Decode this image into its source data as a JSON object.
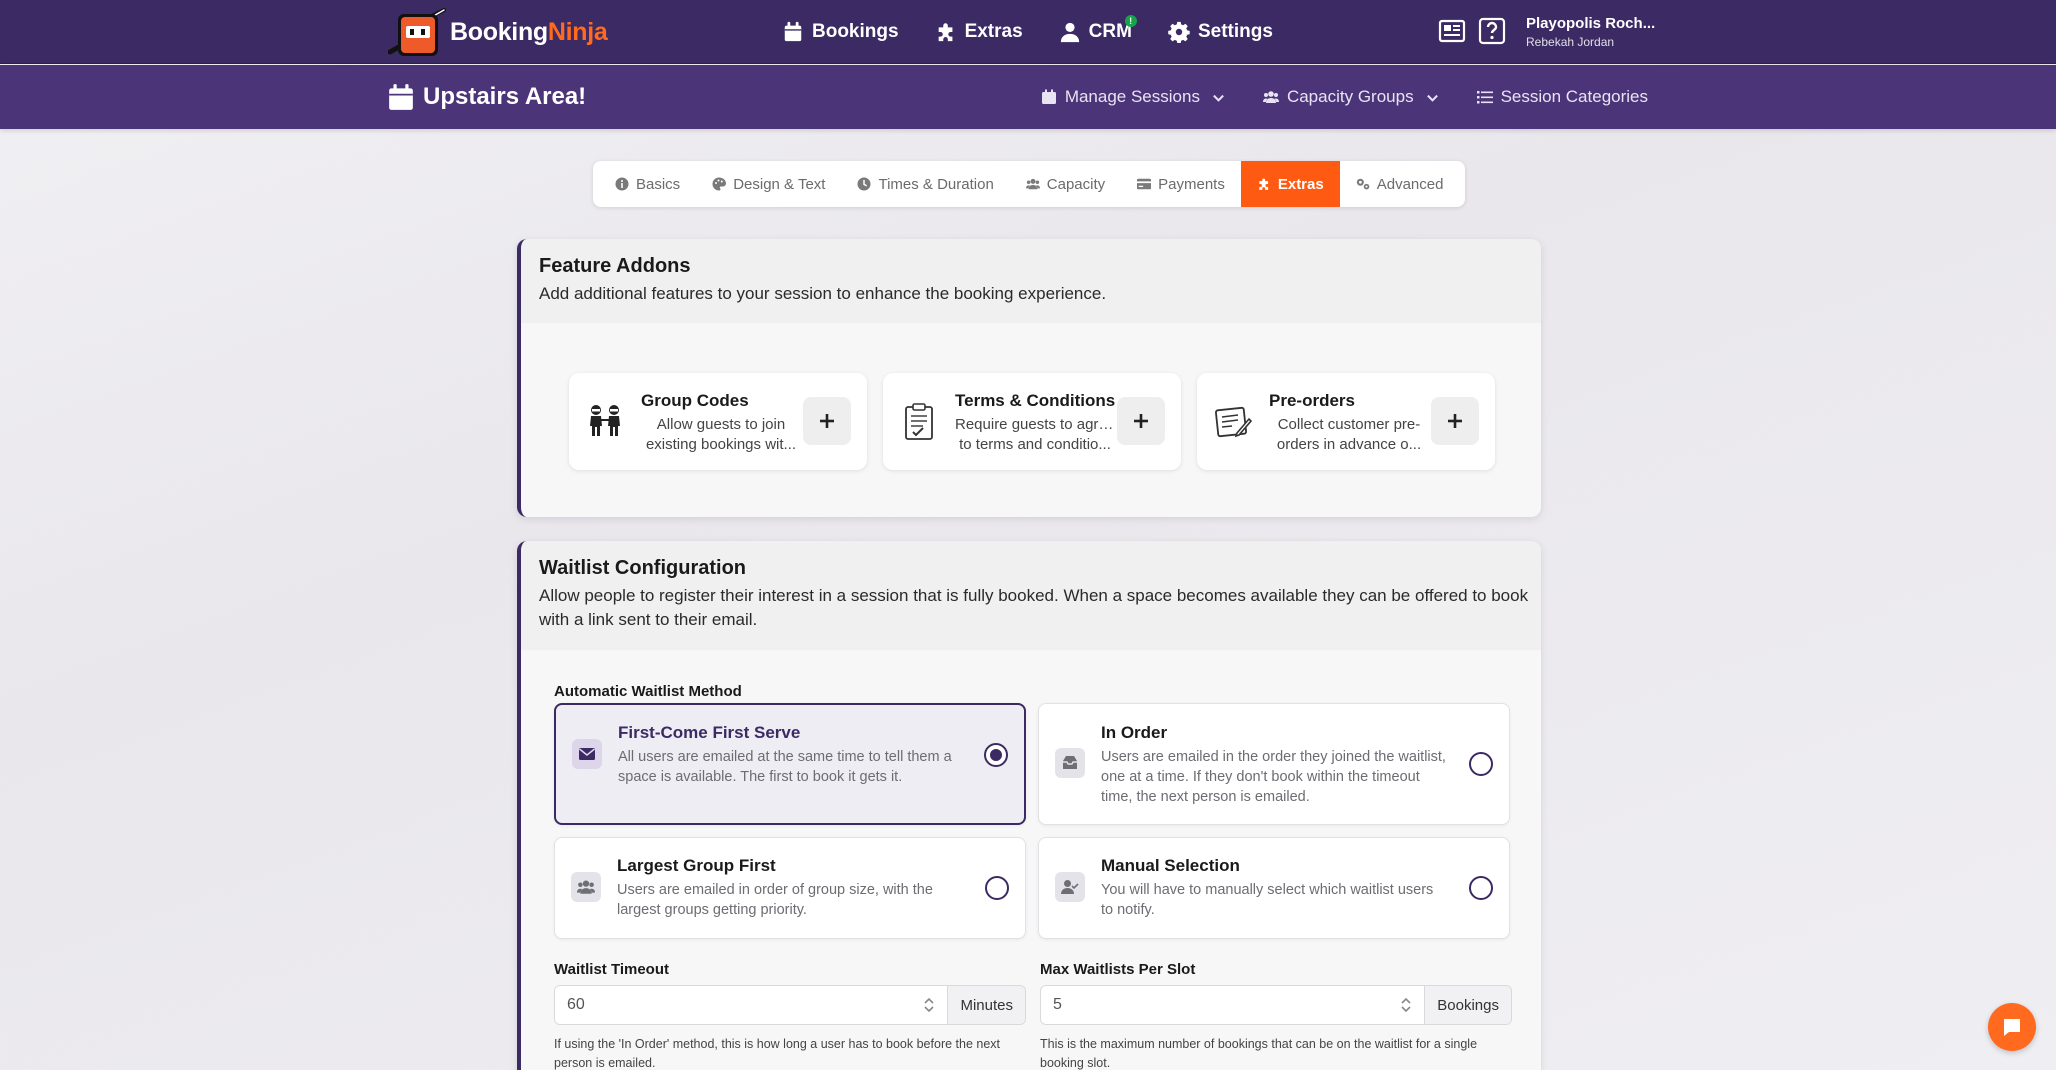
{
  "brand": {
    "name_main": "Booking",
    "name_accent": "Ninja",
    "accent_color": "#ff6a1f",
    "primary_color": "#3b2a63"
  },
  "main_nav": [
    {
      "label": "Bookings",
      "icon": "calendar-icon"
    },
    {
      "label": "Extras",
      "icon": "puzzle-icon"
    },
    {
      "label": "CRM",
      "icon": "user-icon",
      "badge": "!"
    },
    {
      "label": "Settings",
      "icon": "gear-icon"
    }
  ],
  "top_icons": [
    "newspaper-icon",
    "help-icon"
  ],
  "user": {
    "org": "Playopolis Roch...",
    "name": "Rebekah Jordan"
  },
  "page": {
    "title": "Upstairs Area!"
  },
  "sub_nav": [
    {
      "label": "Manage Sessions",
      "icon": "calendar-icon",
      "dropdown": true
    },
    {
      "label": "Capacity Groups",
      "icon": "users-icon",
      "dropdown": true
    },
    {
      "label": "Session Categories",
      "icon": "list-icon",
      "dropdown": false
    }
  ],
  "tabs": [
    {
      "label": "Basics",
      "icon": "info-icon"
    },
    {
      "label": "Design & Text",
      "icon": "palette-icon"
    },
    {
      "label": "Times & Duration",
      "icon": "clock-icon"
    },
    {
      "label": "Capacity",
      "icon": "users-icon"
    },
    {
      "label": "Payments",
      "icon": "credit-card-icon"
    },
    {
      "label": "Extras",
      "icon": "puzzle-icon",
      "active": true
    },
    {
      "label": "Advanced",
      "icon": "cogs-icon"
    }
  ],
  "feature_addons": {
    "title": "Feature Addons",
    "description": "Add additional features to your session to enhance the booking experience.",
    "items": [
      {
        "title": "Group Codes",
        "line1": "Allow guests to join",
        "line2": "existing bookings wit...",
        "icon": "ninjas-icon"
      },
      {
        "title": "Terms & Conditions",
        "line1": "Require guests to agree",
        "line2": "to terms and conditio...",
        "icon": "clipboard-icon"
      },
      {
        "title": "Pre-orders",
        "line1": "Collect customer pre-",
        "line2": "orders in advance o...",
        "icon": "order-form-icon"
      }
    ]
  },
  "waitlist": {
    "title": "Waitlist Configuration",
    "description": "Allow people to register their interest in a session that is fully booked. When a space becomes available they can be offered to book with a link sent to their email.",
    "method_label": "Automatic Waitlist Method",
    "methods": [
      {
        "title": "First-Come First Serve",
        "description": "All users are emailed at the same time to tell them a space is available. The first to book it gets it.",
        "icon": "envelope-icon",
        "selected": true
      },
      {
        "title": "In Order",
        "description": "Users are emailed in the order they joined the waitlist, one at a time. If they don't book within the timeout time, the next person is emailed.",
        "icon": "inbox-icon",
        "selected": false
      },
      {
        "title": "Largest Group First",
        "description": "Users are emailed in order of group size, with the largest groups getting priority.",
        "icon": "users-icon",
        "selected": false
      },
      {
        "title": "Manual Selection",
        "description": "You will have to manually select which waitlist users to notify.",
        "icon": "user-check-icon",
        "selected": false
      }
    ],
    "timeout": {
      "label": "Waitlist Timeout",
      "value": "60",
      "unit": "Minutes",
      "help": "If using the 'In Order' method, this is how long a user has to book before the next person is emailed."
    },
    "max_per_slot": {
      "label": "Max Waitlists Per Slot",
      "value": "5",
      "unit": "Bookings",
      "help": "This is the maximum number of bookings that can be on the waitlist for a single booking slot."
    }
  },
  "chat": {
    "icon": "chat-icon"
  }
}
